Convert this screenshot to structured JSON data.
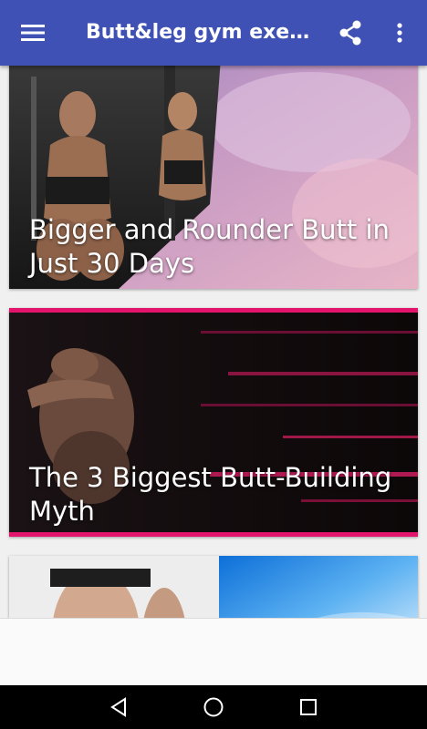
{
  "toolbar": {
    "title": "Butt&leg gym exercises",
    "background": "#3f51b5",
    "icons": [
      "menu-icon",
      "share-icon",
      "more-vert-icon"
    ]
  },
  "articles": [
    {
      "title": "Bigger and Rounder Butt in Just 30 Days"
    },
    {
      "title": "The 3 Biggest Butt-Building Myth"
    },
    {
      "title": ""
    }
  ],
  "navbar": {
    "icons": [
      "back-icon",
      "home-icon",
      "recents-icon"
    ]
  }
}
